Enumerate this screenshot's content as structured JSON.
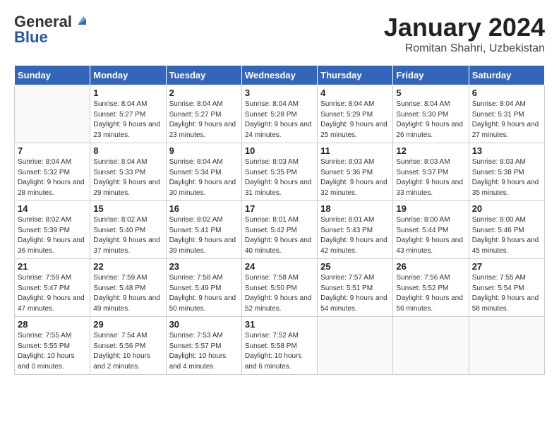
{
  "header": {
    "logo": {
      "line1": "General",
      "line2": "Blue"
    },
    "title": "January 2024",
    "location": "Romitan Shahri, Uzbekistan"
  },
  "weekdays": [
    "Sunday",
    "Monday",
    "Tuesday",
    "Wednesday",
    "Thursday",
    "Friday",
    "Saturday"
  ],
  "weeks": [
    [
      {
        "day": "",
        "sunrise": "",
        "sunset": "",
        "daylight": ""
      },
      {
        "day": "1",
        "sunrise": "Sunrise: 8:04 AM",
        "sunset": "Sunset: 5:27 PM",
        "daylight": "Daylight: 9 hours and 23 minutes."
      },
      {
        "day": "2",
        "sunrise": "Sunrise: 8:04 AM",
        "sunset": "Sunset: 5:27 PM",
        "daylight": "Daylight: 9 hours and 23 minutes."
      },
      {
        "day": "3",
        "sunrise": "Sunrise: 8:04 AM",
        "sunset": "Sunset: 5:28 PM",
        "daylight": "Daylight: 9 hours and 24 minutes."
      },
      {
        "day": "4",
        "sunrise": "Sunrise: 8:04 AM",
        "sunset": "Sunset: 5:29 PM",
        "daylight": "Daylight: 9 hours and 25 minutes."
      },
      {
        "day": "5",
        "sunrise": "Sunrise: 8:04 AM",
        "sunset": "Sunset: 5:30 PM",
        "daylight": "Daylight: 9 hours and 26 minutes."
      },
      {
        "day": "6",
        "sunrise": "Sunrise: 8:04 AM",
        "sunset": "Sunset: 5:31 PM",
        "daylight": "Daylight: 9 hours and 27 minutes."
      }
    ],
    [
      {
        "day": "7",
        "sunrise": "Sunrise: 8:04 AM",
        "sunset": "Sunset: 5:32 PM",
        "daylight": "Daylight: 9 hours and 28 minutes."
      },
      {
        "day": "8",
        "sunrise": "Sunrise: 8:04 AM",
        "sunset": "Sunset: 5:33 PM",
        "daylight": "Daylight: 9 hours and 29 minutes."
      },
      {
        "day": "9",
        "sunrise": "Sunrise: 8:04 AM",
        "sunset": "Sunset: 5:34 PM",
        "daylight": "Daylight: 9 hours and 30 minutes."
      },
      {
        "day": "10",
        "sunrise": "Sunrise: 8:03 AM",
        "sunset": "Sunset: 5:35 PM",
        "daylight": "Daylight: 9 hours and 31 minutes."
      },
      {
        "day": "11",
        "sunrise": "Sunrise: 8:03 AM",
        "sunset": "Sunset: 5:36 PM",
        "daylight": "Daylight: 9 hours and 32 minutes."
      },
      {
        "day": "12",
        "sunrise": "Sunrise: 8:03 AM",
        "sunset": "Sunset: 5:37 PM",
        "daylight": "Daylight: 9 hours and 33 minutes."
      },
      {
        "day": "13",
        "sunrise": "Sunrise: 8:03 AM",
        "sunset": "Sunset: 5:38 PM",
        "daylight": "Daylight: 9 hours and 35 minutes."
      }
    ],
    [
      {
        "day": "14",
        "sunrise": "Sunrise: 8:02 AM",
        "sunset": "Sunset: 5:39 PM",
        "daylight": "Daylight: 9 hours and 36 minutes."
      },
      {
        "day": "15",
        "sunrise": "Sunrise: 8:02 AM",
        "sunset": "Sunset: 5:40 PM",
        "daylight": "Daylight: 9 hours and 37 minutes."
      },
      {
        "day": "16",
        "sunrise": "Sunrise: 8:02 AM",
        "sunset": "Sunset: 5:41 PM",
        "daylight": "Daylight: 9 hours and 39 minutes."
      },
      {
        "day": "17",
        "sunrise": "Sunrise: 8:01 AM",
        "sunset": "Sunset: 5:42 PM",
        "daylight": "Daylight: 9 hours and 40 minutes."
      },
      {
        "day": "18",
        "sunrise": "Sunrise: 8:01 AM",
        "sunset": "Sunset: 5:43 PM",
        "daylight": "Daylight: 9 hours and 42 minutes."
      },
      {
        "day": "19",
        "sunrise": "Sunrise: 8:00 AM",
        "sunset": "Sunset: 5:44 PM",
        "daylight": "Daylight: 9 hours and 43 minutes."
      },
      {
        "day": "20",
        "sunrise": "Sunrise: 8:00 AM",
        "sunset": "Sunset: 5:46 PM",
        "daylight": "Daylight: 9 hours and 45 minutes."
      }
    ],
    [
      {
        "day": "21",
        "sunrise": "Sunrise: 7:59 AM",
        "sunset": "Sunset: 5:47 PM",
        "daylight": "Daylight: 9 hours and 47 minutes."
      },
      {
        "day": "22",
        "sunrise": "Sunrise: 7:59 AM",
        "sunset": "Sunset: 5:48 PM",
        "daylight": "Daylight: 9 hours and 49 minutes."
      },
      {
        "day": "23",
        "sunrise": "Sunrise: 7:58 AM",
        "sunset": "Sunset: 5:49 PM",
        "daylight": "Daylight: 9 hours and 50 minutes."
      },
      {
        "day": "24",
        "sunrise": "Sunrise: 7:58 AM",
        "sunset": "Sunset: 5:50 PM",
        "daylight": "Daylight: 9 hours and 52 minutes."
      },
      {
        "day": "25",
        "sunrise": "Sunrise: 7:57 AM",
        "sunset": "Sunset: 5:51 PM",
        "daylight": "Daylight: 9 hours and 54 minutes."
      },
      {
        "day": "26",
        "sunrise": "Sunrise: 7:56 AM",
        "sunset": "Sunset: 5:52 PM",
        "daylight": "Daylight: 9 hours and 56 minutes."
      },
      {
        "day": "27",
        "sunrise": "Sunrise: 7:55 AM",
        "sunset": "Sunset: 5:54 PM",
        "daylight": "Daylight: 9 hours and 58 minutes."
      }
    ],
    [
      {
        "day": "28",
        "sunrise": "Sunrise: 7:55 AM",
        "sunset": "Sunset: 5:55 PM",
        "daylight": "Daylight: 10 hours and 0 minutes."
      },
      {
        "day": "29",
        "sunrise": "Sunrise: 7:54 AM",
        "sunset": "Sunset: 5:56 PM",
        "daylight": "Daylight: 10 hours and 2 minutes."
      },
      {
        "day": "30",
        "sunrise": "Sunrise: 7:53 AM",
        "sunset": "Sunset: 5:57 PM",
        "daylight": "Daylight: 10 hours and 4 minutes."
      },
      {
        "day": "31",
        "sunrise": "Sunrise: 7:52 AM",
        "sunset": "Sunset: 5:58 PM",
        "daylight": "Daylight: 10 hours and 6 minutes."
      },
      {
        "day": "",
        "sunrise": "",
        "sunset": "",
        "daylight": ""
      },
      {
        "day": "",
        "sunrise": "",
        "sunset": "",
        "daylight": ""
      },
      {
        "day": "",
        "sunrise": "",
        "sunset": "",
        "daylight": ""
      }
    ]
  ]
}
